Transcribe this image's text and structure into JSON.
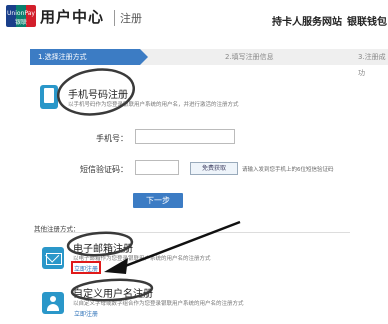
{
  "header": {
    "logo_text": "UnionPay 银联",
    "title": "用户中心",
    "subtitle": "注册",
    "nav": [
      "持卡人服务网站",
      "银联钱包"
    ]
  },
  "steps": [
    "1.选择注册方式",
    "2.填写注册信息",
    "3.注册成功"
  ],
  "phone_option": {
    "icon": "phone-icon",
    "title": "手机号码注册",
    "description": "以手机号码作为您登录银联用户系统的用户名，并进行激活的注册方式"
  },
  "form": {
    "phone_label": "手机号：",
    "phone_value": "",
    "code_label": "短信验证码：",
    "code_value": "",
    "code_button": "免费获取",
    "code_hint": "请输入发到您手机上的6位短信验证码",
    "next_button": "下一步"
  },
  "other_methods_label": "其他注册方式：",
  "email_option": {
    "icon": "mail-icon",
    "title": "电子邮箱注册",
    "description": "以电子邮箱作为您登录银联用户系统的用户名的注册方式",
    "link": "立即注册"
  },
  "custom_option": {
    "icon": "user-icon",
    "title": "自定义用户名注册",
    "description": "以自定义字母或数字组合作为您登录银联用户系统的用户名的注册方式",
    "link": "立即注册"
  },
  "colors": {
    "accent": "#3c7cc4",
    "icon": "#2a97c9",
    "annotation": "#e01a1a"
  }
}
